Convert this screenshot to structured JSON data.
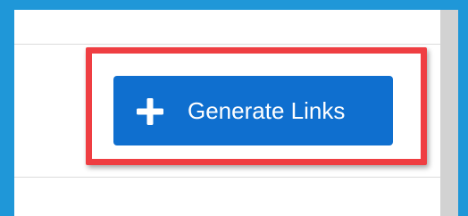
{
  "toolbar": {
    "generate_links_label": "Generate Links",
    "generate_links_icon": "plus-icon"
  },
  "colors": {
    "frame_blue": "#1f97d8",
    "button_blue": "#0f6fcf",
    "highlight_red": "#ef3e42",
    "scrollbar_gray": "#d2d2d2"
  }
}
